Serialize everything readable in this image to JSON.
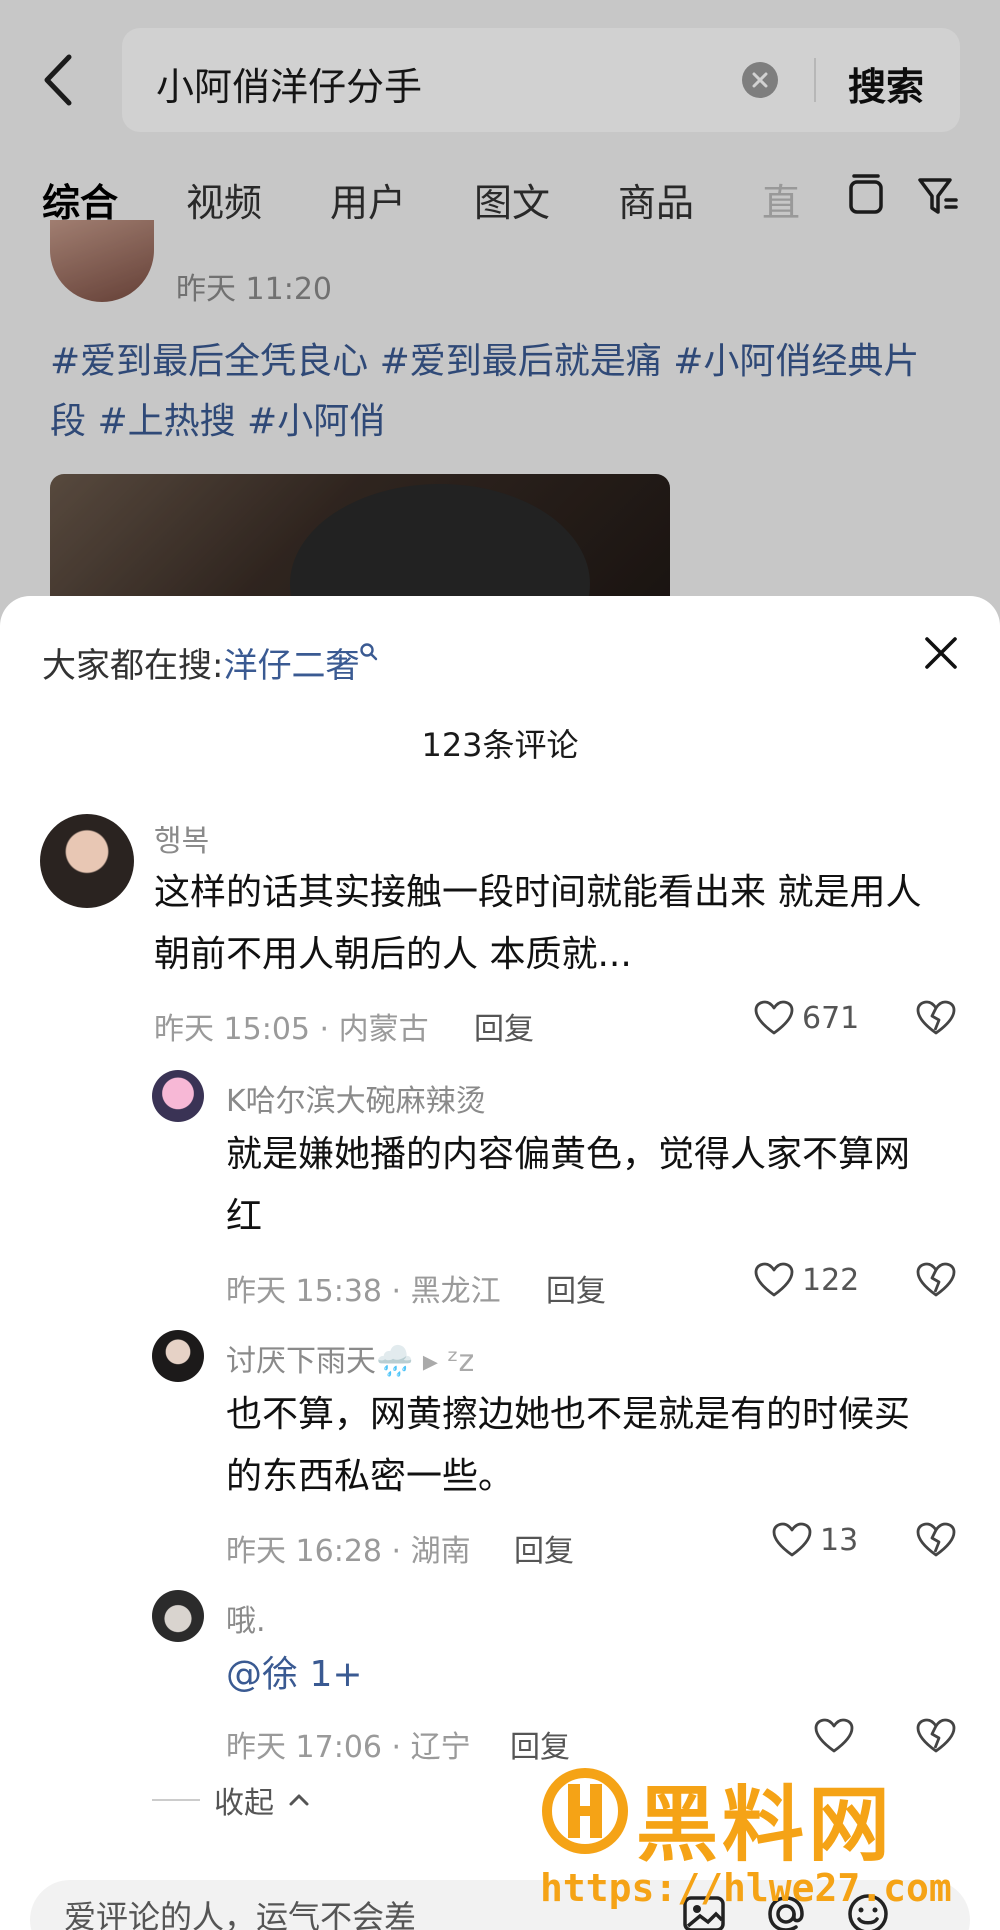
{
  "search": {
    "query": "小阿俏洋仔分手",
    "button_label": "搜索"
  },
  "tabs": [
    {
      "label": "综合",
      "active": true
    },
    {
      "label": "视频",
      "active": false
    },
    {
      "label": "用户",
      "active": false
    },
    {
      "label": "图文",
      "active": false
    },
    {
      "label": "商品",
      "active": false
    },
    {
      "label": "直",
      "active": false
    }
  ],
  "post": {
    "time": "昨天 11:20",
    "tags_line1": "#爱到最后全凭良心 #爱到最后就是痛 #小阿俏经典片",
    "tags_line2": "段  #上热搜 #小阿俏"
  },
  "sheet": {
    "trending_label": "大家都在搜:",
    "trending_link": "洋仔二奢",
    "comment_count": "123条评论",
    "collapse_label": "收起"
  },
  "comments": [
    {
      "name": "행복",
      "text_line1": "这样的话其实接触一段时间就能看出来 就是用人",
      "text_line2": "朝前不用人朝后的人 本质就...",
      "meta": "昨天 15:05 · 内蒙古",
      "reply": "回复",
      "likes": "671"
    },
    {
      "name": "K哈尔滨大碗麻辣烫",
      "text_line1": "就是嫌她播的内容偏黄色，觉得人家不算网",
      "text_line2": "红",
      "meta": "昨天 15:38 · 黑龙江",
      "reply": "回复",
      "likes": "122"
    },
    {
      "name": "讨厌下雨天🌧️",
      "name_suffix": "▸ ᶻz",
      "text_line1": "也不算，网黄擦边她也不是就是有的时候买",
      "text_line2": "的东西私密一些。",
      "meta": "昨天 16:28 · 湖南",
      "reply": "回复",
      "likes": "13"
    },
    {
      "name": "哦.",
      "text_line1": "@徐 1+",
      "meta": "昨天 17:06 · 辽宁",
      "reply": "回复",
      "likes": ""
    }
  ],
  "input": {
    "placeholder": "爱评论的人，运气不会差"
  },
  "watermark": {
    "title": "黑料网",
    "url": "https://hlwe27.com"
  },
  "colors": {
    "link": "#3a5a92",
    "watermark": "#f5a316"
  }
}
